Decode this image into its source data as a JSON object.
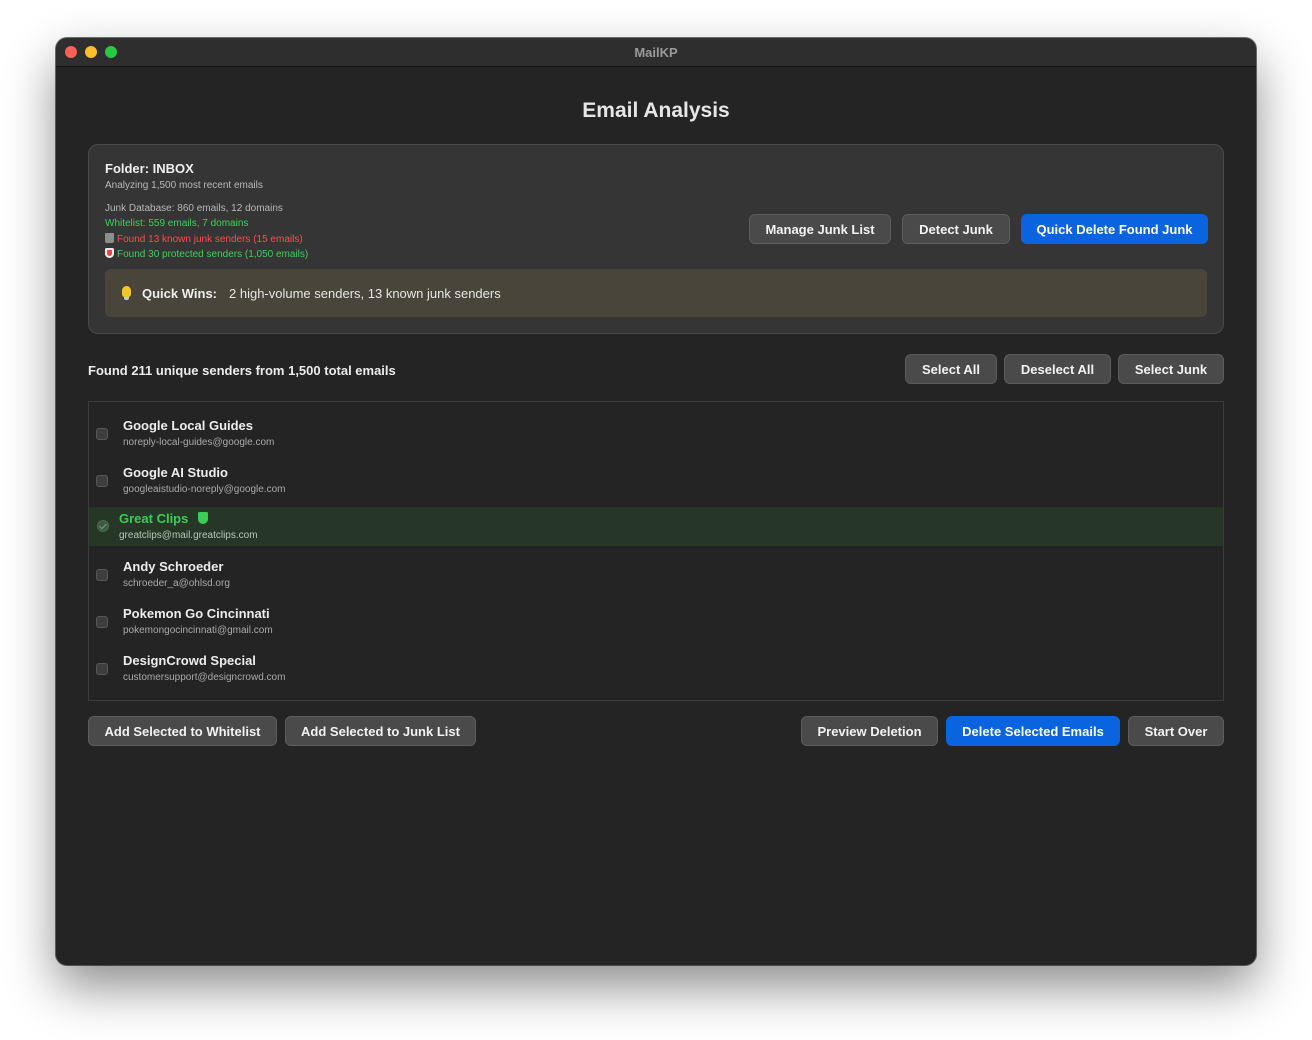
{
  "window": {
    "title": "MailKP"
  },
  "page_title": "Email Analysis",
  "info": {
    "folder": "Folder: INBOX",
    "analyzing": "Analyzing 1,500 most recent emails",
    "junk_db": "Junk Database: 860 emails, 12 domains",
    "whitelist": "Whitelist: 559 emails, 7 domains",
    "found_junk": "Found 13 known junk senders (15 emails)",
    "found_protected": "Found 30 protected senders (1,050 emails)",
    "buttons": {
      "manage": "Manage Junk List",
      "detect": "Detect Junk",
      "quick_delete": "Quick Delete Found Junk"
    },
    "quick_wins": {
      "label": "Quick Wins:",
      "text": "2 high-volume senders, 13 known junk senders"
    }
  },
  "list_header": {
    "found": "Found 211 unique senders from 1,500 total emails",
    "select_all": "Select All",
    "deselect_all": "Deselect All",
    "select_junk": "Select Junk"
  },
  "senders": [
    {
      "name": "Google Local Guides",
      "email": "noreply-local-guides@google.com"
    },
    {
      "name": "Google AI Studio",
      "email": "googleaistudio-noreply@google.com"
    },
    {
      "name": "Great Clips",
      "email": "greatclips@mail.greatclips.com"
    },
    {
      "name": "Andy Schroeder",
      "email": "schroeder_a@ohlsd.org"
    },
    {
      "name": "Pokemon Go Cincinnati",
      "email": "pokemongocincinnati@gmail.com"
    },
    {
      "name": "DesignCrowd Special",
      "email": "customersupport@designcrowd.com"
    }
  ],
  "footer": {
    "add_whitelist": "Add Selected to Whitelist",
    "add_junk": "Add Selected to Junk List",
    "preview": "Preview Deletion",
    "delete": "Delete Selected Emails",
    "start_over": "Start Over"
  },
  "colors": {
    "accent": "#0a64e0",
    "whitelist_green": "#3ccc56",
    "junk_red": "#ff4b4b"
  }
}
